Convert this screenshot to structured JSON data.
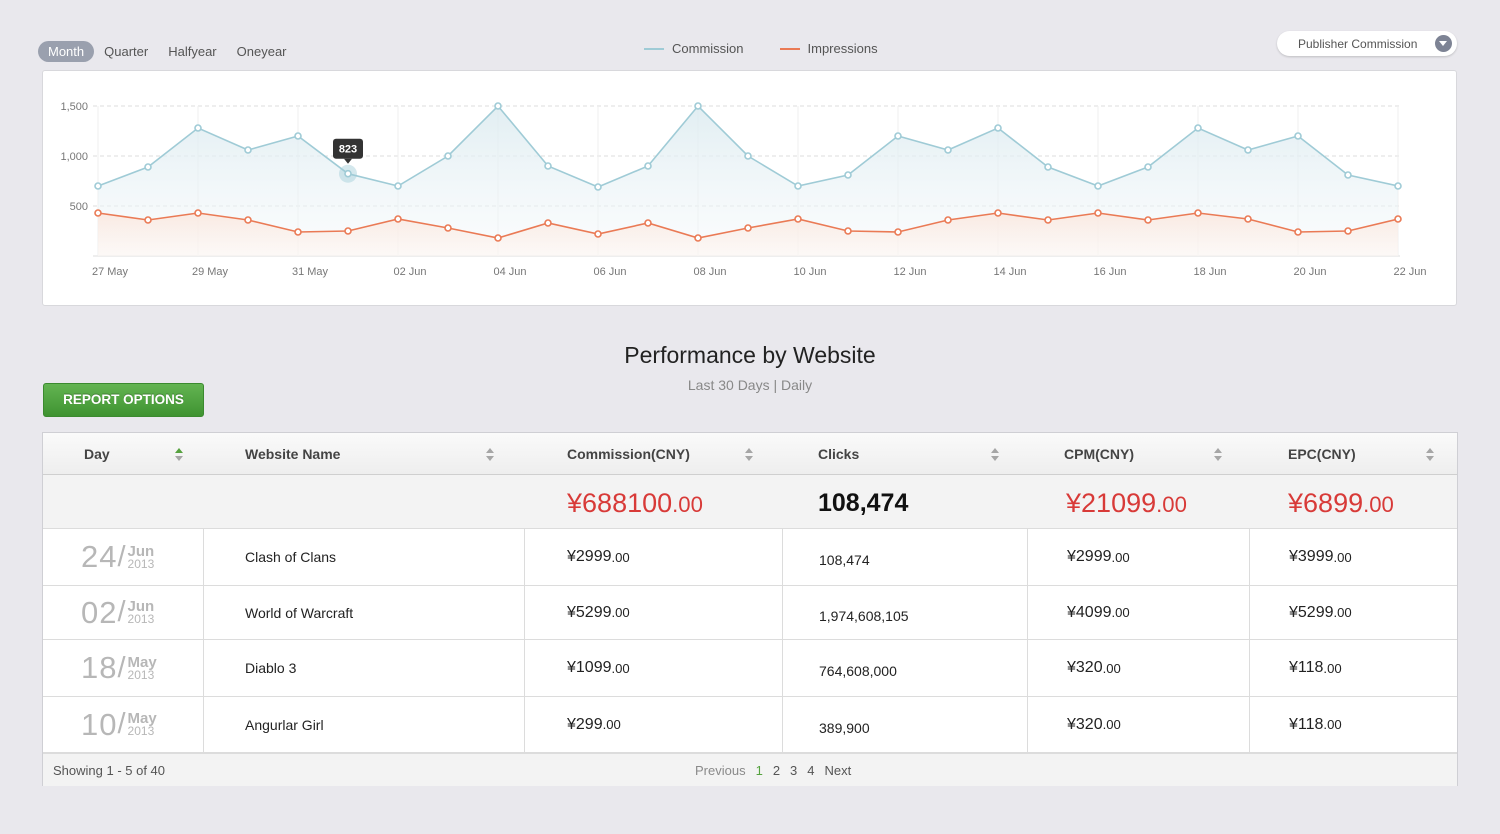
{
  "period_tabs": [
    {
      "label": "Month",
      "active": true
    },
    {
      "label": "Quarter",
      "active": false
    },
    {
      "label": "Halfyear",
      "active": false
    },
    {
      "label": "Oneyear",
      "active": false
    }
  ],
  "legend": [
    {
      "label": "Commission",
      "color": "#9fcbd6"
    },
    {
      "label": "Impressions",
      "color": "#ea7a55"
    }
  ],
  "dropdown": {
    "value": "Publisher Commission"
  },
  "chart_data": {
    "type": "area",
    "y_ticks": [
      "1,500",
      "1,000",
      "500"
    ],
    "ylim": [
      0,
      1500
    ],
    "x": [
      "27 May",
      "28 May",
      "29 May",
      "30 May",
      "31 May",
      "01 Jun",
      "02 Jun",
      "03 Jun",
      "04 Jun",
      "05 Jun",
      "06 Jun",
      "07 Jun",
      "08 Jun",
      "09 Jun",
      "10 Jun",
      "11 Jun",
      "12 Jun",
      "13 Jun",
      "14 Jun",
      "15 Jun",
      "16 Jun",
      "17 Jun",
      "18 Jun",
      "19 Jun",
      "20 Jun",
      "21 Jun",
      "22 Jun"
    ],
    "x_ticks": [
      "27 May",
      "29 May",
      "31 May",
      "02 Jun",
      "04 Jun",
      "06 Jun",
      "08 Jun",
      "10 Jun",
      "12 Jun",
      "14 Jun",
      "16 Jun",
      "18 Jun",
      "20 Jun",
      "22 Jun"
    ],
    "series": [
      {
        "name": "Commission",
        "color": "#9fcbd6",
        "values": [
          700,
          890,
          1280,
          1060,
          1200,
          823,
          700,
          1000,
          1500,
          900,
          690,
          900,
          1500,
          1000,
          700,
          810,
          1200,
          1060,
          1280,
          890,
          700,
          890,
          1280,
          1060,
          1200,
          810,
          700
        ]
      },
      {
        "name": "Impressions",
        "color": "#ea7a55",
        "values": [
          430,
          360,
          430,
          360,
          240,
          250,
          370,
          280,
          180,
          330,
          220,
          330,
          180,
          280,
          370,
          250,
          240,
          360,
          430,
          360,
          430,
          360,
          430,
          370,
          240,
          250,
          370
        ]
      }
    ],
    "tooltip": {
      "label": "823",
      "index": 5
    }
  },
  "section": {
    "title": "Performance by Website",
    "subtitle": "Last 30 Days | Daily"
  },
  "report_button": "REPORT OPTIONS",
  "table": {
    "columns": [
      "Day",
      "Website Name",
      "Commission(CNY)",
      "Clicks",
      "CPM(CNY)",
      "EPC(CNY)"
    ],
    "totals": {
      "commission": {
        "symbol": "¥",
        "int": "688100",
        "dec": ".00"
      },
      "clicks": "108,474",
      "cpm": {
        "symbol": "¥",
        "int": "21099",
        "dec": ".00"
      },
      "epc": {
        "symbol": "¥",
        "int": "6899",
        "dec": ".00"
      }
    },
    "rows": [
      {
        "day": "24",
        "month": "Jun",
        "year": "2013",
        "site": "Clash of Clans",
        "commission": {
          "symbol": "¥",
          "int": "2999",
          "dec": ".00"
        },
        "clicks": "108,474",
        "cpm": {
          "symbol": "¥",
          "int": "2999",
          "dec": ".00"
        },
        "epc": {
          "symbol": "¥",
          "int": "3999",
          "dec": ".00"
        }
      },
      {
        "day": "02",
        "month": "Jun",
        "year": "2013",
        "site": "World of Warcraft",
        "commission": {
          "symbol": "¥",
          "int": "5299",
          "dec": ".00"
        },
        "clicks": "1,974,608,105",
        "cpm": {
          "symbol": "¥",
          "int": "4099",
          "dec": ".00"
        },
        "epc": {
          "symbol": "¥",
          "int": "5299",
          "dec": ".00"
        }
      },
      {
        "day": "18",
        "month": "May",
        "year": "2013",
        "site": "Diablo 3",
        "commission": {
          "symbol": "¥",
          "int": "1099",
          "dec": ".00"
        },
        "clicks": "764,608,000",
        "cpm": {
          "symbol": "¥",
          "int": "320",
          "dec": ".00"
        },
        "epc": {
          "symbol": "¥",
          "int": "118",
          "dec": ".00"
        }
      },
      {
        "day": "10",
        "month": "May",
        "year": "2013",
        "site": "Angurlar Girl",
        "commission": {
          "symbol": "¥",
          "int": "299",
          "dec": ".00"
        },
        "clicks": "389,900",
        "cpm": {
          "symbol": "¥",
          "int": "320",
          "dec": ".00"
        },
        "epc": {
          "symbol": "¥",
          "int": "118",
          "dec": ".00"
        }
      }
    ],
    "footer": {
      "showing": "Showing 1 - 5 of 40",
      "previous": "Previous",
      "pages": [
        "1",
        "2",
        "3",
        "4"
      ],
      "next": "Next"
    }
  }
}
